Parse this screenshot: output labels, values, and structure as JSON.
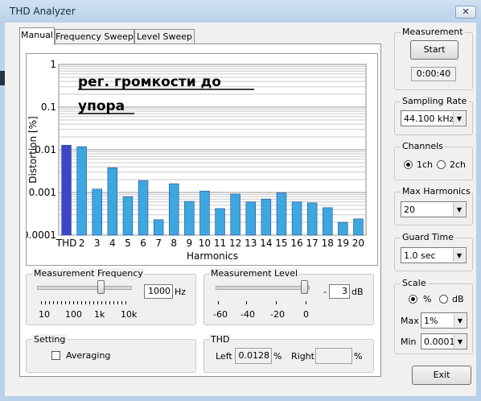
{
  "window": {
    "title": "THD Analyzer",
    "close_glyph": "✕"
  },
  "tabs": [
    {
      "label": "Manual",
      "active": true
    },
    {
      "label": "Frequency Sweep",
      "active": false
    },
    {
      "label": "Level Sweep",
      "active": false
    }
  ],
  "chart_data": {
    "type": "bar",
    "title": "",
    "annotation": [
      "рег. громкости до",
      "упора"
    ],
    "xlabel": "Harmonics",
    "ylabel": "Distortion [%]",
    "yscale": "log",
    "ylim": [
      0.0001,
      1
    ],
    "ytick_labels": [
      "1",
      "0.1",
      "0.01",
      "0.001",
      "0.0001"
    ],
    "categories": [
      "THD",
      "2",
      "3",
      "4",
      "5",
      "6",
      "7",
      "8",
      "9",
      "10",
      "11",
      "12",
      "13",
      "14",
      "15",
      "16",
      "17",
      "18",
      "19",
      "20"
    ],
    "values": [
      0.0128,
      0.0118,
      0.0012,
      0.0038,
      0.0008,
      0.0019,
      0.00023,
      0.0016,
      0.00062,
      0.00108,
      0.00042,
      0.00092,
      0.0006,
      0.0007,
      0.00097,
      0.0006,
      0.00057,
      0.00044,
      0.0002,
      0.00024
    ],
    "colors": {
      "thd": "#3f45c9",
      "harmonic": "#3ea7e0",
      "grid": "#c8c8c8"
    },
    "grid": true
  },
  "measurement_frequency": {
    "title": "Measurement Frequency",
    "value": "1000",
    "unit": "Hz",
    "scale_labels": [
      "10",
      "100",
      "1k",
      "10k"
    ]
  },
  "measurement_level": {
    "title": "Measurement Level",
    "prefix": "-",
    "value": "3",
    "unit": "dB",
    "scale_labels": [
      "-60",
      "-40",
      "-20",
      "0"
    ]
  },
  "setting": {
    "title": "Setting",
    "averaging_label": "Averaging",
    "averaging_checked": false
  },
  "thd": {
    "title": "THD",
    "left_label": "Left",
    "left_value": "0.0128",
    "left_unit": "%",
    "right_label": "Right",
    "right_value": "",
    "right_unit": "%"
  },
  "measurement": {
    "title": "Measurement",
    "start_label": "Start",
    "elapsed": "0:00:40"
  },
  "sampling_rate": {
    "title": "Sampling Rate",
    "selected": "44.100 kHz"
  },
  "channels": {
    "title": "Channels",
    "option1": "1ch",
    "option2": "2ch",
    "selected": "1ch"
  },
  "max_harmonics": {
    "title": "Max Harmonics",
    "selected": "20"
  },
  "guard_time": {
    "title": "Guard Time",
    "selected": "1.0 sec"
  },
  "scale": {
    "title": "Scale",
    "option_percent": "%",
    "option_db": "dB",
    "selected": "%",
    "max_label": "Max",
    "max_value": "1%",
    "min_label": "Min",
    "min_value": "0.0001:"
  },
  "exit_label": "Exit"
}
